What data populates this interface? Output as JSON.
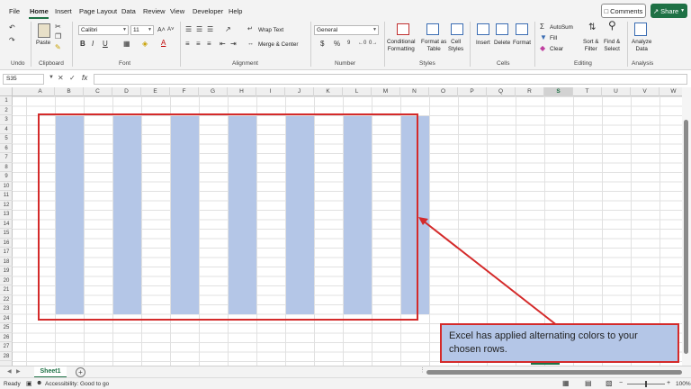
{
  "menu": {
    "items": [
      "File",
      "Home",
      "Insert",
      "Page Layout",
      "Data",
      "Review",
      "View",
      "Developer",
      "Help"
    ],
    "active": "Home",
    "comments_label": "Comments",
    "share_label": "Share"
  },
  "ribbon": {
    "undo": {
      "label": "Undo"
    },
    "clipboard": {
      "paste_label": "Paste",
      "group_label": "Clipboard"
    },
    "font": {
      "font_name": "Calibri",
      "font_size": "11",
      "group_label": "Font"
    },
    "alignment": {
      "wrap_text_label": "Wrap Text",
      "merge_center_label": "Merge & Center",
      "group_label": "Alignment"
    },
    "number": {
      "format": "General",
      "currency_symbol": "$",
      "percent_symbol": "%",
      "group_label": "Number"
    },
    "styles": {
      "conditional_formatting": [
        "Conditional",
        "Formatting"
      ],
      "format_as_table": [
        "Format as",
        "Table"
      ],
      "cell_styles": [
        "Cell",
        "Styles"
      ],
      "group_label": "Styles"
    },
    "cells": {
      "insert_label": "Insert",
      "delete_label": "Delete",
      "format_label": "Format",
      "group_label": "Cells"
    },
    "editing": {
      "autosum_label": "AutoSum",
      "fill_label": "Fill",
      "clear_label": "Clear",
      "sort_filter": [
        "Sort &",
        "Filter"
      ],
      "find_select": [
        "Find &",
        "Select"
      ],
      "group_label": "Editing"
    },
    "analysis": {
      "analyze_data": [
        "Analyze",
        "Data"
      ],
      "group_label": "Analysis"
    }
  },
  "formula_bar": {
    "name_box": "S35",
    "fx_label": "fx",
    "value": ""
  },
  "grid": {
    "columns": [
      "A",
      "B",
      "C",
      "D",
      "E",
      "F",
      "G",
      "H",
      "I",
      "J",
      "K",
      "L",
      "M",
      "N",
      "O",
      "P",
      "Q",
      "R",
      "S",
      "T",
      "U",
      "V",
      "W"
    ],
    "selected_column": "S",
    "rows": [
      "1",
      "2",
      "3",
      "4",
      "5",
      "6",
      "7",
      "8",
      "9",
      "10",
      "11",
      "12",
      "13",
      "14",
      "15",
      "16",
      "17",
      "18",
      "19",
      "20",
      "21",
      "22",
      "23",
      "24",
      "25",
      "26",
      "27",
      "28"
    ],
    "banded_columns": [
      "B",
      "D",
      "F",
      "H",
      "J",
      "L",
      "N"
    ],
    "band_color": "#b4c6e7",
    "highlight_color": "#d42a2a"
  },
  "callout": {
    "text": "Excel has applied alternating colors to your chosen rows."
  },
  "sheets": {
    "tabs": [
      "Sheet1"
    ],
    "active": "Sheet1"
  },
  "status": {
    "ready": "Ready",
    "accessibility": "Accessibility: Good to go",
    "zoom": "100%"
  }
}
